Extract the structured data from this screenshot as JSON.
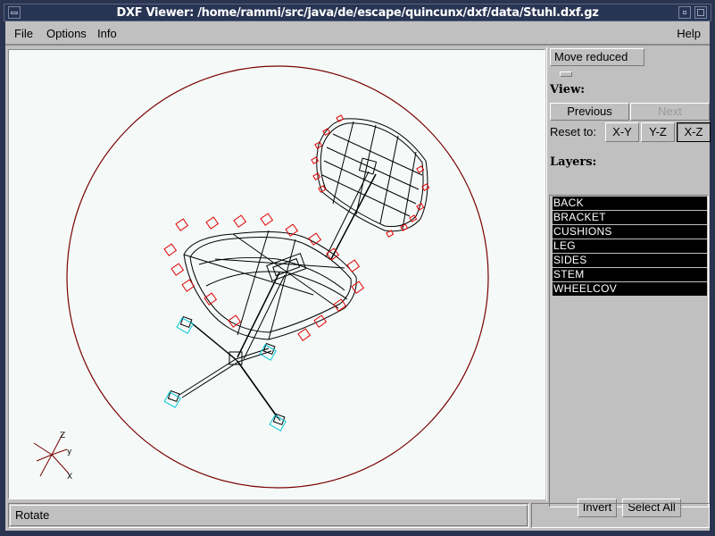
{
  "window": {
    "title": "DXF Viewer: /home/rammi/src/java/de/escape/quincunx/dxf/data/Stuhl.dxf.gz"
  },
  "menu": {
    "items": [
      "File",
      "Options",
      "Info"
    ],
    "help": "Help"
  },
  "sidebar": {
    "mode_select": "Move reduced",
    "view_heading": "View:",
    "previous_label": "Previous",
    "next_label": "Next",
    "reset_label": "Reset to:",
    "reset_buttons": [
      "X-Y",
      "Y-Z",
      "X-Z"
    ],
    "reset_selected": "X-Z",
    "layers_heading": "Layers:",
    "layers": [
      "BACK",
      "BRACKET",
      "CUSHIONS",
      "LEG",
      "SIDES",
      "STEM",
      "WHEELCOV"
    ],
    "invert_label": "Invert",
    "select_all_label": "Select All"
  },
  "status": {
    "text": "Rotate",
    "secondary": ""
  },
  "axes": {
    "x_label": "X",
    "y_label": "Y",
    "z_label": "Z"
  },
  "colors": {
    "bounding_circle": "#7a0000",
    "cushion_markers": "#e00000",
    "wireframe": "#000000",
    "wheels": "#00c8d8",
    "axes": "#7a0000",
    "canvas_bg": "#f5faf8"
  }
}
